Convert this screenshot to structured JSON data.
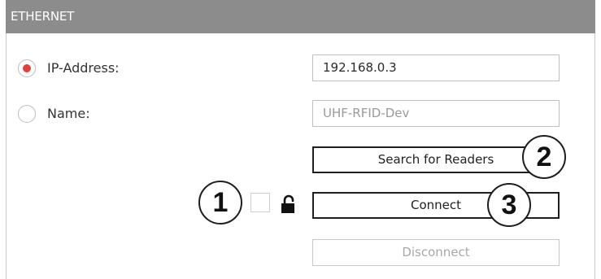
{
  "header": {
    "title": "ETHERNET"
  },
  "connection": {
    "ip_option": {
      "label": "IP-Address:",
      "selected": true
    },
    "name_option": {
      "label": "Name:",
      "selected": false
    },
    "ip_value": "192.168.0.3",
    "name_placeholder": "UHF-RFID-Dev"
  },
  "buttons": {
    "search": "Search for Readers",
    "connect": "Connect",
    "disconnect": "Disconnect"
  },
  "callouts": [
    "1",
    "2",
    "3"
  ],
  "icons": {
    "lock": "unlocked-padlock-icon"
  },
  "colors": {
    "header_bg": "#8c8c8c",
    "radio_selected": "#e2403a",
    "button_border": "#1e1e1e",
    "disabled_text": "#a8a8a8"
  }
}
